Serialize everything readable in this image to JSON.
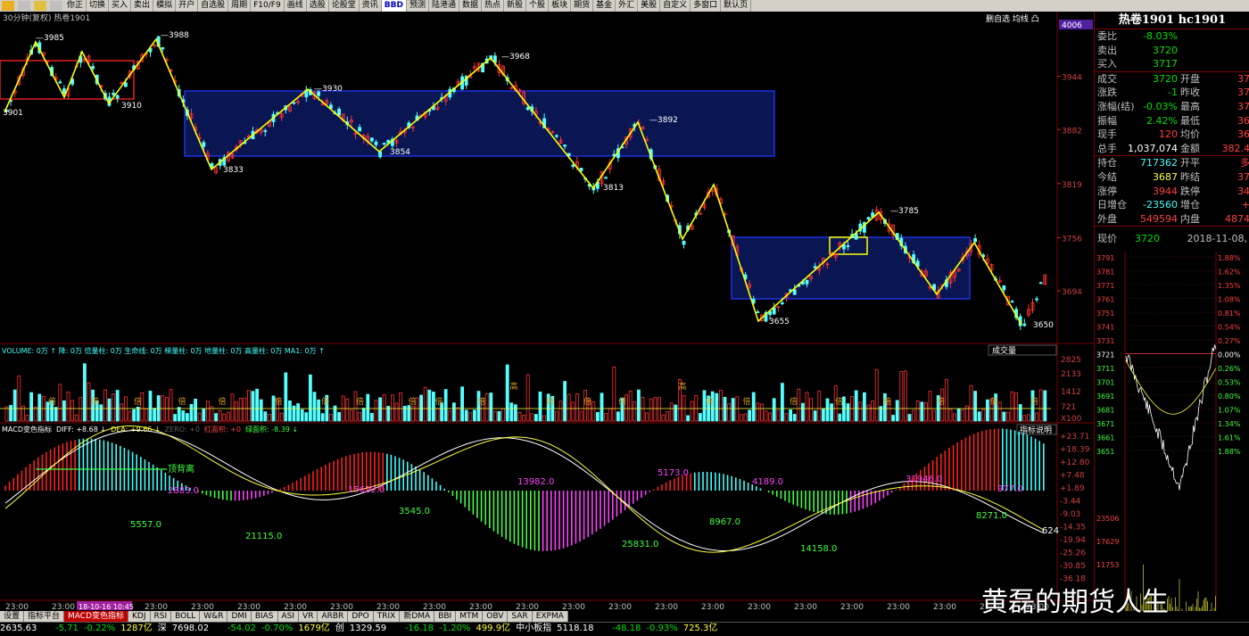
{
  "toolbar": {
    "items": [
      "",
      "",
      "",
      "",
      "你正",
      "切换",
      "买入",
      "卖出",
      "模拟",
      "开户",
      "自选股",
      "周期",
      "F10/F9",
      "画线",
      "选股",
      "论股堂",
      "资讯",
      "BBD",
      "预测",
      "陆港通",
      "数据",
      "热点",
      "新股",
      "个股",
      "板块",
      "期货",
      "基金",
      "外汇",
      "美股",
      "自定义",
      "多窗口",
      "默认页"
    ],
    "selected": "BBD"
  },
  "chart_header": {
    "title": "30分钟(复权) 热卷1901",
    "right": "删自选 均线 凸"
  },
  "price_axis": {
    "top": "4006",
    "ticks": [
      "3944",
      "3882",
      "3819",
      "3756",
      "3694"
    ]
  },
  "pivots": [
    {
      "label": "3985"
    },
    {
      "label": "3988"
    },
    {
      "label": "3901"
    },
    {
      "label": "3910"
    },
    {
      "label": "3930"
    },
    {
      "label": "3833"
    },
    {
      "label": "3854"
    },
    {
      "label": "3968"
    },
    {
      "label": "3892"
    },
    {
      "label": "3813"
    },
    {
      "label": "3785"
    },
    {
      "label": "3655"
    },
    {
      "label": "3650"
    }
  ],
  "volume": {
    "header": "VOLUME: 0万 ↑ 降: 0万 倍量柱: 0万 生命线: 0万 梯量柱: 0万 地量柱: 0万 高量柱: 0万 MA1: 0万 ↑",
    "button": "成交量",
    "ticks": [
      "2825",
      "2133",
      "1412",
      "721",
      "X100"
    ],
    "tags": [
      "倍",
      "倍",
      "倍",
      "倍",
      "倍",
      "倍",
      "倍",
      "倍",
      "倍",
      "倍",
      "倍",
      "高",
      "倍",
      "倍",
      "倍",
      "高",
      "倍",
      "倍",
      "倍",
      "倍",
      "倍",
      "倍",
      "倍",
      "倍"
    ]
  },
  "macd": {
    "header_name": "MACD变色指标",
    "diff": "DIFF: +8.68 ↓",
    "dea": "DEA: +9.66 ↓",
    "zero": "ZERO: +0",
    "red": "红面积: +0",
    "green": "绿面积: -8.39 ↓",
    "button": "指标说明",
    "ticks": [
      "+23.71",
      "+18.39",
      "+12.80",
      "+7.48",
      "+1.89",
      "-3.44",
      "-9.03",
      "-14.35",
      "-19.94",
      "-25.26",
      "-30.85",
      "-36.18"
    ],
    "areas": [
      "5557.0",
      "2883.0",
      "15622.0",
      "3545.0",
      "21115.0",
      "13982.0",
      "25831.0",
      "5173.0",
      "8967.0",
      "4189.0",
      "14158.0",
      "31946.0",
      "8271.0",
      "977.0",
      "624"
    ],
    "note": "顶背离"
  },
  "time_axis": [
    "23:00",
    "23:00",
    "23:00",
    "23:00",
    "23:00",
    "23:00",
    "23:00",
    "23:00",
    "23:00",
    "23:00",
    "23:00",
    "23:00",
    "23:00",
    "23:00",
    "23:00",
    "23:00",
    "23:00",
    "23:00",
    "23:00",
    "23:00",
    "23:00",
    "23:00",
    "23:00"
  ],
  "time_highlight": "18-10-16 10:45",
  "side": {
    "title": "热卷1901 hc1901",
    "rows1": [
      {
        "l": "委比",
        "v": "-8.03%",
        "c": "grn"
      },
      {
        "l": "卖出",
        "v": "3720",
        "c": "grn"
      },
      {
        "l": "买入",
        "v": "3717",
        "c": "grn"
      }
    ],
    "rows2": [
      {
        "l": "成交",
        "v": "3720",
        "c": "grn",
        "l2": "开盘",
        "v2": "37"
      },
      {
        "l": "涨跌",
        "v": "-1",
        "c": "grn",
        "l2": "昨收",
        "v2": "37"
      },
      {
        "l": "涨幅(结)",
        "v": "-0.03%",
        "c": "grn",
        "l2": "最高",
        "v2": "37"
      },
      {
        "l": "振幅",
        "v": "2.42%",
        "c": "grn",
        "l2": "最低",
        "v2": "36"
      },
      {
        "l": "现手",
        "v": "120",
        "c": "red",
        "l2": "均价",
        "v2": "36"
      },
      {
        "l": "总手",
        "v": "1,037,074",
        "c": "wht",
        "l2": "金额",
        "v2": "382.4"
      }
    ],
    "rows3": [
      {
        "l": "持仓",
        "v": "717362",
        "c": "cyan",
        "l2": "开平",
        "v2": "多"
      },
      {
        "l": "今结",
        "v": "3687",
        "c": "yel",
        "l2": "昨结",
        "v2": "37"
      },
      {
        "l": "涨停",
        "v": "3944",
        "c": "red",
        "l2": "跌停",
        "v2": "34"
      },
      {
        "l": "日增仓",
        "v": "-23560",
        "c": "cyan",
        "l2": "增仓",
        "v2": "+"
      },
      {
        "l": "外盘",
        "v": "549594",
        "c": "red",
        "l2": "内盘",
        "v2": "4874"
      }
    ],
    "now_label": "现价",
    "now_value": "3720",
    "now_date": "2018-11-08,",
    "mini_prices": [
      "3791",
      "3781",
      "3771",
      "3761",
      "3751",
      "3741",
      "3731",
      "3721",
      "3711",
      "3701",
      "3691",
      "3681",
      "3671",
      "3661",
      "3651"
    ],
    "mini_pcts": [
      "1.88%",
      "1.62%",
      "1.35%",
      "1.08%",
      "0.81%",
      "0.54%",
      "0.27%",
      "0.00%",
      "0.26%",
      "0.53%",
      "0.80%",
      "1.07%",
      "1.34%",
      "1.61%",
      "1.88%"
    ],
    "mini_vol": [
      "23506",
      "17629",
      "11753"
    ]
  },
  "tabs": [
    "设置",
    "指标平台",
    "MACD变色指标",
    "KDJ",
    "RSI",
    "BOLL",
    "W&R",
    "DMI",
    "BIAS",
    "ASI",
    "VR",
    "ARBR",
    "DPO",
    "TRIX",
    "新DMA",
    "BBI",
    "MTM",
    "OBV",
    "SAR",
    "EXPMA"
  ],
  "active_tab": "MACD变色指标",
  "status": [
    "2635.63",
    "-5.71",
    "-0.22%",
    "1287亿",
    "深",
    "7698.02",
    "-54.02",
    "-0.70%",
    "1679亿",
    "创",
    "1329.59",
    "-16.18",
    "-1.20%",
    "499.9亿",
    "中小板指",
    "5118.18",
    "-48.18",
    "-0.93%",
    "725.3亿"
  ],
  "watermark": "黄磊的期货人生",
  "colors": {
    "up": "#ff3232",
    "down": "#54ffff",
    "box": "#0a1a60",
    "box_edge": "#2030e0",
    "zigzag": "#ffff00",
    "axis": "#7a0000"
  }
}
